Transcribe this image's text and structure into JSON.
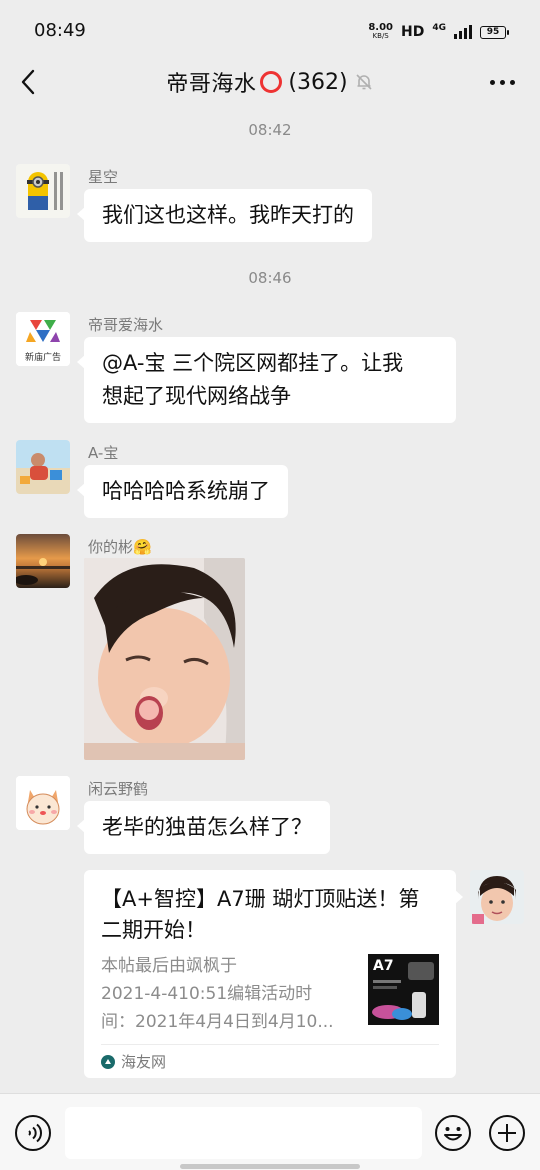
{
  "status": {
    "time": "08:49",
    "speed_value": "8.00",
    "speed_unit": "KB/S",
    "hd": "HD",
    "network": "4G",
    "battery": "95"
  },
  "header": {
    "back_icon": "chevron-left-icon",
    "title": "帝哥海水",
    "title_emoji": "⭕",
    "member_count": "(362)",
    "mute_icon": "bell-off-icon",
    "more_icon": "more-dots-icon"
  },
  "messages": {
    "ts1": "08:42",
    "m1": {
      "sender": "星空",
      "text": "我们这也这样。我昨天打的"
    },
    "ts2": "08:46",
    "m2": {
      "sender": "帝哥爱海水",
      "text_line1": "@A-宝  三个院区网都挂了。让我",
      "text_line2": "想起了现代网络战争",
      "avatar_caption": "新庙广告"
    },
    "m3": {
      "sender": "A-宝",
      "text": "哈哈哈哈系统崩了"
    },
    "m4": {
      "sender": "你的彬",
      "sender_emoji": "🤗"
    },
    "m5": {
      "sender": "闲云野鹤",
      "text": "老毕的独苗怎么样了？"
    }
  },
  "shared_card": {
    "title_line1": "【A+智控】A7珊 瑚灯顶贴送！第",
    "title_line2": "二期开始！",
    "desc_line1": "本帖最后由飒枫于",
    "desc_line2": "2021-4-410:51编辑活动时",
    "desc_line3": "间：2021年4月4日到4月10...",
    "thumb_label": "A7",
    "source": "海友网"
  },
  "input": {
    "placeholder": "",
    "voice_icon": "voice-icon",
    "emoji_icon": "emoji-icon",
    "plus_icon": "plus-icon"
  }
}
